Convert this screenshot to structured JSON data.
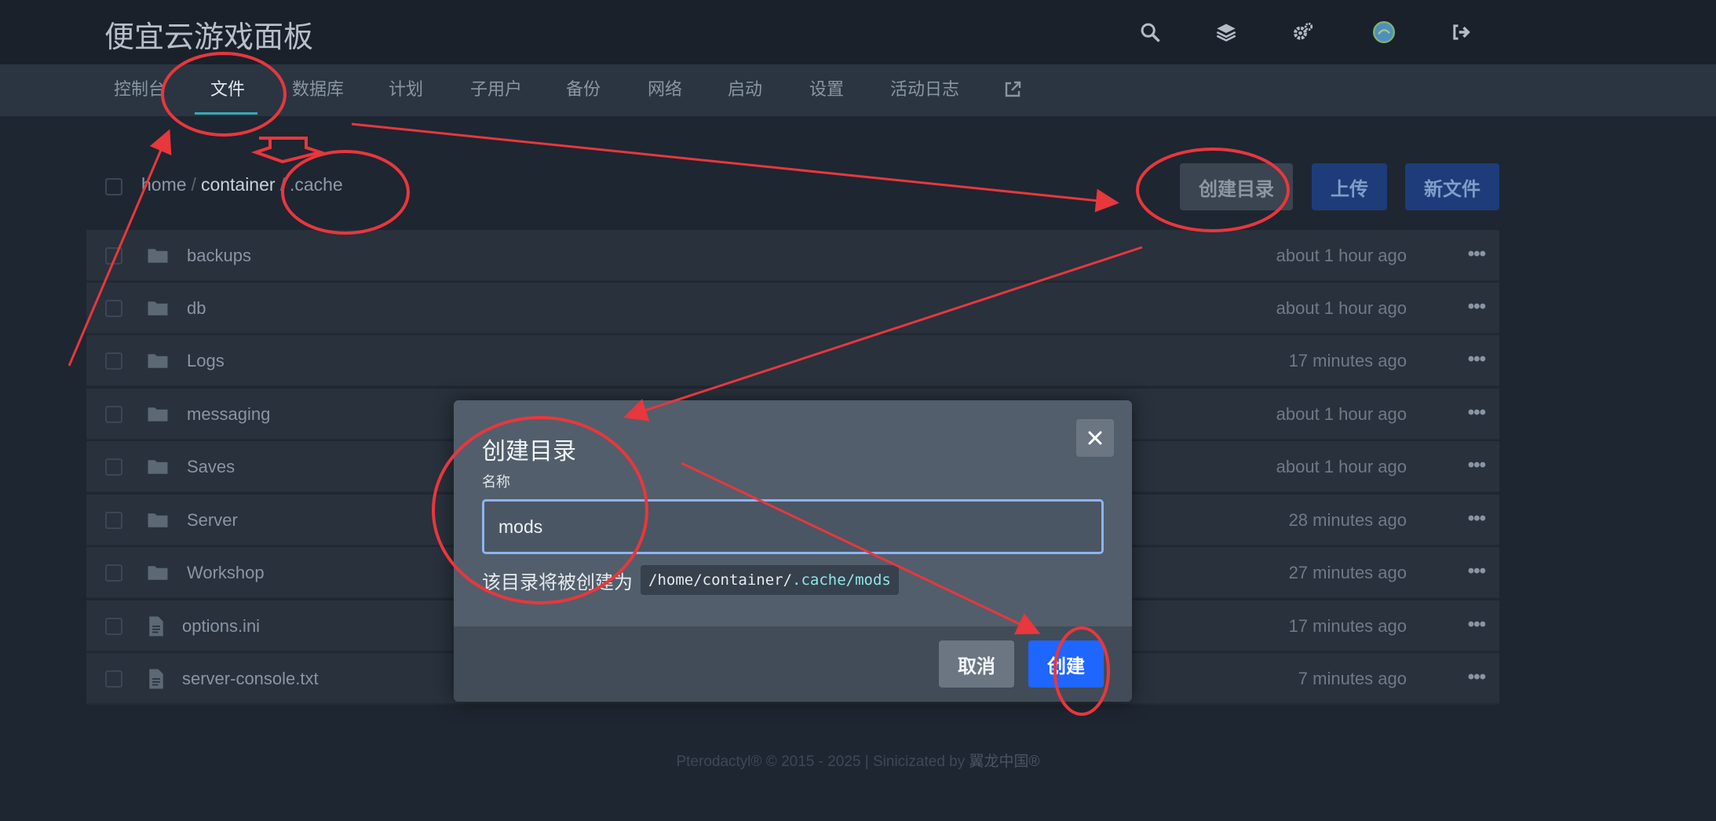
{
  "header": {
    "brand": "便宜云游戏面板"
  },
  "top_icons": [
    "search-icon",
    "layers-icon",
    "cogs-icon",
    "avatar",
    "logout-icon"
  ],
  "nav": {
    "items": [
      {
        "label": "控制台"
      },
      {
        "label": "文件"
      },
      {
        "label": "数据库"
      },
      {
        "label": "计划"
      },
      {
        "label": "子用户"
      },
      {
        "label": "备份"
      },
      {
        "label": "网络"
      },
      {
        "label": "启动"
      },
      {
        "label": "设置"
      },
      {
        "label": "活动日志"
      }
    ],
    "active": "文件"
  },
  "breadcrumb": {
    "slash": "/",
    "parts": [
      "home",
      "container",
      ".cache"
    ]
  },
  "actions": {
    "mkdir": "创建目录",
    "upload": "上传",
    "new_file": "新文件"
  },
  "files": [
    {
      "name": "backups",
      "time": "about 1 hour ago",
      "type": "folder"
    },
    {
      "name": "db",
      "time": "about 1 hour ago",
      "type": "folder"
    },
    {
      "name": "Logs",
      "time": "17 minutes ago",
      "type": "folder"
    },
    {
      "name": "messaging",
      "time": "about 1 hour ago",
      "type": "folder"
    },
    {
      "name": "Saves",
      "time": "about 1 hour ago",
      "type": "folder"
    },
    {
      "name": "Server",
      "time": "28 minutes ago",
      "type": "folder"
    },
    {
      "name": "Workshop",
      "time": "27 minutes ago",
      "type": "folder"
    },
    {
      "name": "options.ini",
      "time": "17 minutes ago",
      "type": "file"
    },
    {
      "name": "server-console.txt",
      "time": "7 minutes ago",
      "type": "file"
    }
  ],
  "row_menu": "•••",
  "footer": {
    "text": "Pterodactyl® © 2015 - 2025 | Sinicizated by",
    "link": "翼龙中国®"
  },
  "modal": {
    "title": "创建目录",
    "field_label": "名称",
    "input_value": "mods",
    "hint": "该目录将被创建为",
    "path_prefix": "/home/container/",
    "path_highlight": ".cache/mods",
    "cancel": "取消",
    "create": "创建"
  },
  "colors": {
    "background": "#1e2631",
    "accent_blue": "#1f66ff",
    "annotation_red": "#e8373d",
    "tab_underline": "#3aa7b5"
  }
}
